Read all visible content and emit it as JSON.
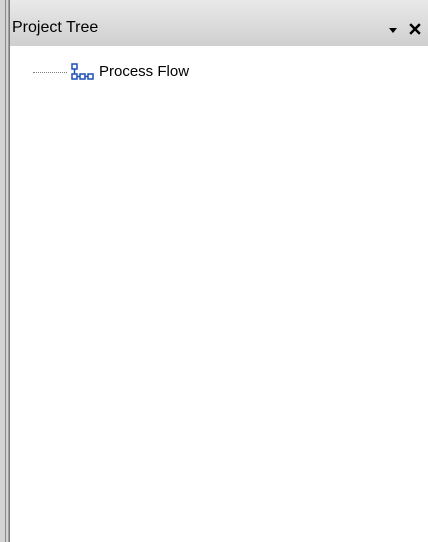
{
  "panel": {
    "title": "Project Tree",
    "dropdown_icon": "chevron-down-icon",
    "close_icon": "close-icon"
  },
  "tree": {
    "items": [
      {
        "label": "Process Flow",
        "icon": "process-flow-icon"
      }
    ]
  },
  "colors": {
    "titlebar_top": "#e9e9e9",
    "titlebar_bottom": "#cfcfcf",
    "icon_blue": "#1f4fb8",
    "background": "#ffffff"
  }
}
